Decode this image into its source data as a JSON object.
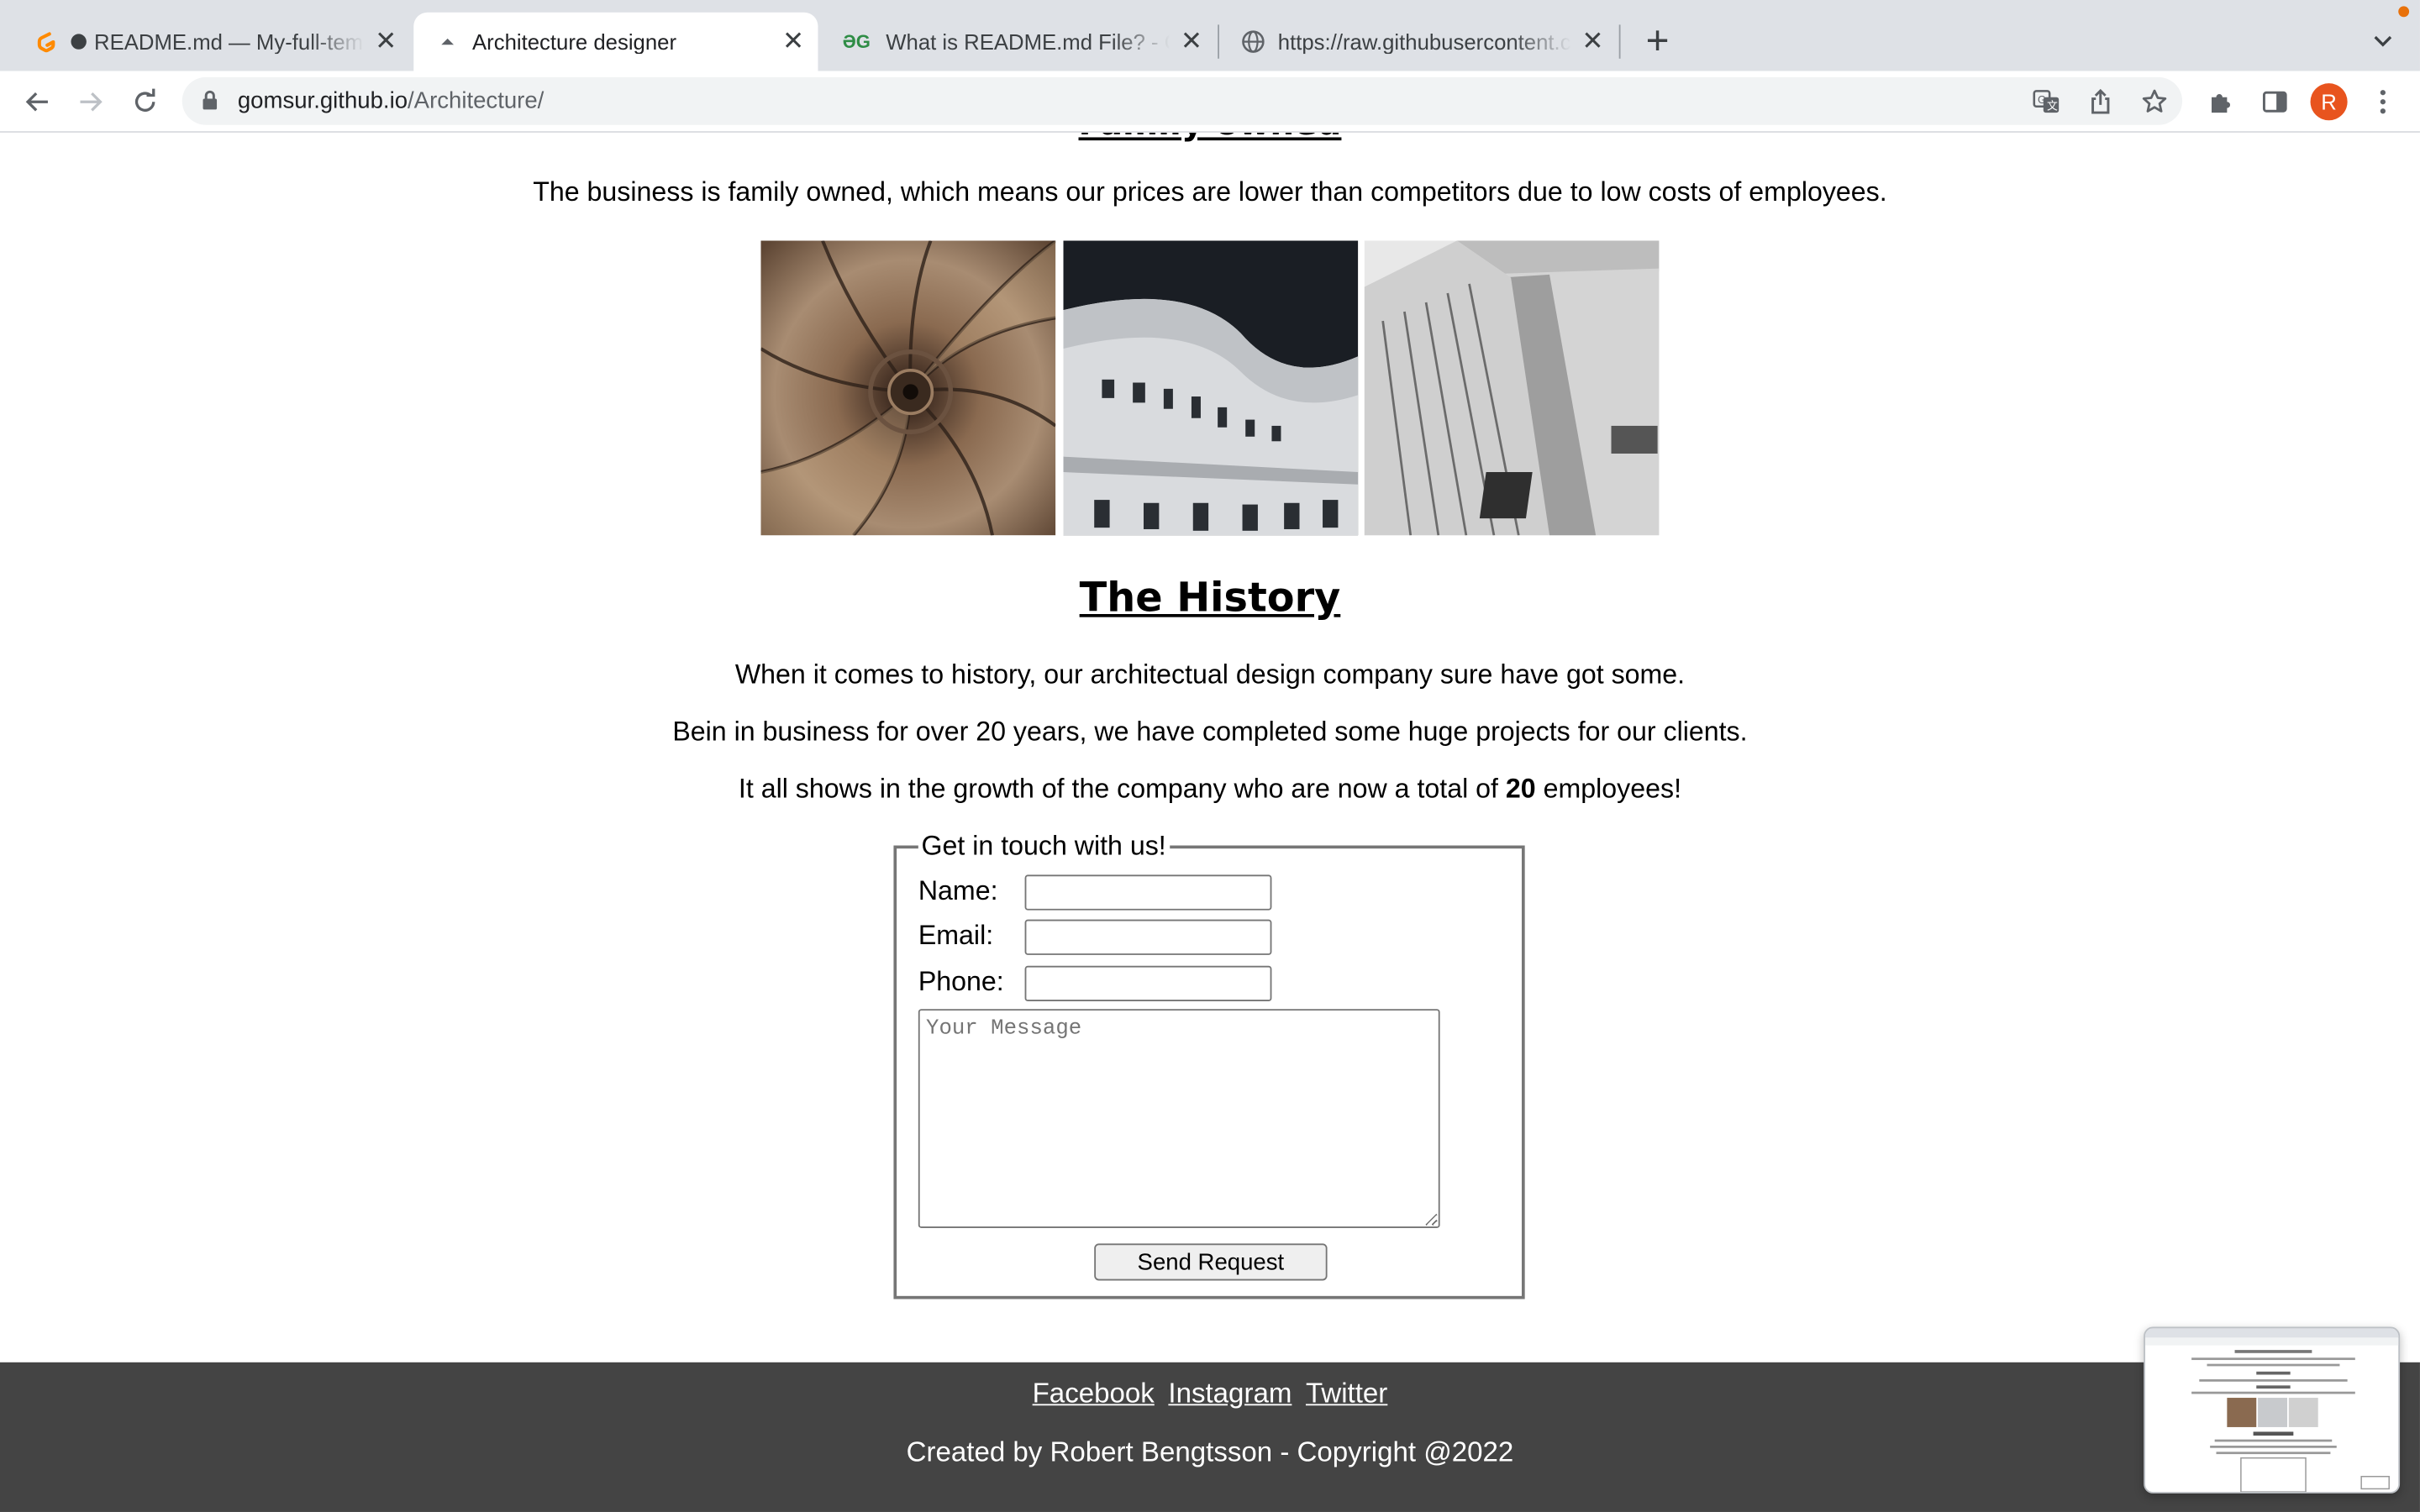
{
  "browser": {
    "tabs": [
      {
        "title": "README.md — My-full-template",
        "active": false
      },
      {
        "title": "Architecture designer",
        "active": true
      },
      {
        "title": "What is README.md File? - GeeksforGeeks",
        "active": false
      },
      {
        "title": "https://raw.githubusercontent.com",
        "active": false
      }
    ],
    "url_host": "gomsur.github.io",
    "url_path": "/Architecture/",
    "profile_initial": "R",
    "accent_color": "#e8541e"
  },
  "page": {
    "clipped_heading": "Family owned",
    "family_text": "The business is family owned, which means our prices are lower than competitors due to low costs of employees.",
    "gallery_alts": [
      "Spiral staircase",
      "White curved building",
      "Glass building"
    ],
    "history": {
      "heading": "The History",
      "line1": "When it comes to history, our architectual design company sure have got some.",
      "line2": "Bein in business for over 20 years, we have completed some huge projects for our clients.",
      "line3_before": "It all shows in the growth of the company who are now a total of",
      "line3_bold": "20",
      "line3_after": "employees!"
    },
    "contact": {
      "legend": "Get in touch with us!",
      "name_label": "Name:",
      "email_label": "Email:",
      "phone_label": "Phone:",
      "message_placeholder": "Your Message",
      "send_label": "Send Request"
    },
    "footer": {
      "links": [
        "Facebook",
        "Instagram",
        "Twitter"
      ],
      "credit": "Created by Robert Bengtsson - Copyright @2022"
    }
  }
}
